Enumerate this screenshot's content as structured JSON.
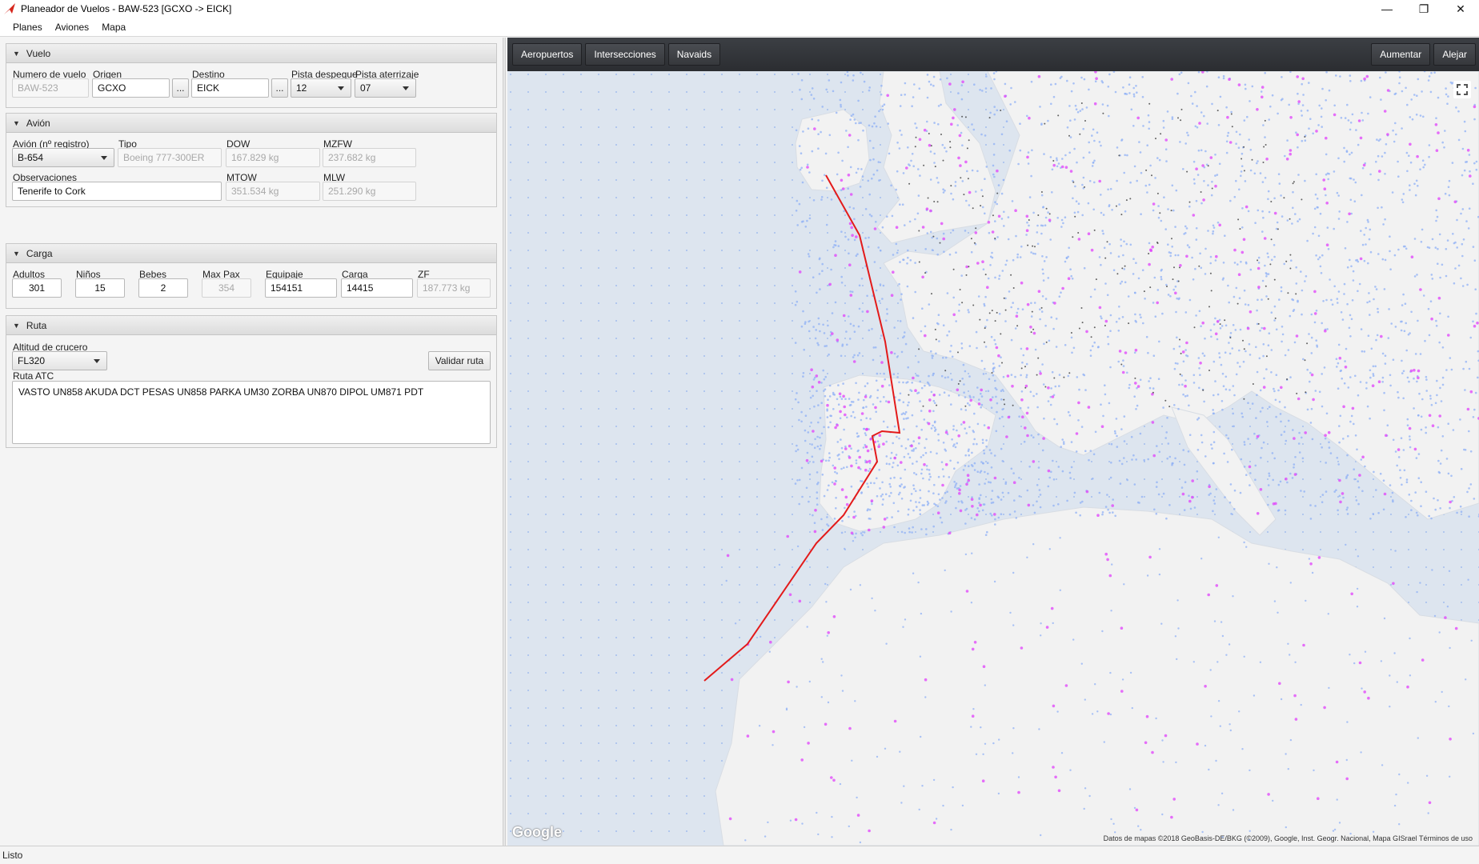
{
  "window": {
    "title": "Planeador de Vuelos - BAW-523 [GCXO -> EICK]",
    "minimize": "—",
    "restore": "❐",
    "close": "✕"
  },
  "menu": [
    "Planes",
    "Aviones",
    "Mapa"
  ],
  "vuelo": {
    "header": "Vuelo",
    "numero_label": "Numero de vuelo",
    "numero_value": "BAW-523",
    "origen_label": "Origen",
    "origen_value": "GCXO",
    "destino_label": "Destino",
    "destino_value": "EICK",
    "browse_label": "...",
    "pista_despegue_label": "Pista despegue",
    "pista_despegue_value": "12",
    "pista_aterrizaje_label": "Pista aterrizaje",
    "pista_aterrizaje_value": "07"
  },
  "avion": {
    "header": "Avión",
    "registro_label": "Avión (nº registro)",
    "registro_value": "B-654",
    "tipo_label": "Tipo",
    "tipo_value": "Boeing 777-300ER",
    "dow_label": "DOW",
    "dow_value": "167.829 kg",
    "mzfw_label": "MZFW",
    "mzfw_value": "237.682 kg",
    "observaciones_label": "Observaciones",
    "observaciones_value": "Tenerife to Cork",
    "mtow_label": "MTOW",
    "mtow_value": "351.534 kg",
    "mlw_label": "MLW",
    "mlw_value": "251.290 kg"
  },
  "carga": {
    "header": "Carga",
    "adultos_label": "Adultos",
    "adultos_value": "301",
    "ninos_label": "Niños",
    "ninos_value": "15",
    "bebes_label": "Bebes",
    "bebes_value": "2",
    "maxpax_label": "Max Pax",
    "maxpax_value": "354",
    "equipaje_label": "Equipaje",
    "equipaje_value": "154151",
    "carga_label": "Carga",
    "carga_value": "14415",
    "zf_label": "ZF",
    "zf_value": "187.773 kg"
  },
  "ruta": {
    "header": "Ruta",
    "altitud_label": "Altitud de crucero",
    "altitud_value": "FL320",
    "validar_label": "Validar ruta",
    "atc_label": "Ruta ATC",
    "atc_value": "VASTO UN858 AKUDA DCT PESAS UN858 PARKA UM30 ZORBA UN870 DIPOL UM871 PDT"
  },
  "map": {
    "tabs": [
      "Aeropuertos",
      "Intersecciones",
      "Navaids"
    ],
    "zoom_in": "Aumentar",
    "zoom_out": "Alejar",
    "logo": "Google",
    "attribution": "Datos de mapas ©2018 GeoBasis-DE/BKG (©2009), Google, Inst. Geogr. Nacional, Mapa GISrael    Términos de uso",
    "colors": {
      "route": "#e31a1a",
      "land": "#f2f2f2",
      "sea": "#dde5ef",
      "airport": "#e040fb",
      "intersection": "#8fb0f5",
      "navaid": "#333333"
    }
  },
  "status": "Listo"
}
